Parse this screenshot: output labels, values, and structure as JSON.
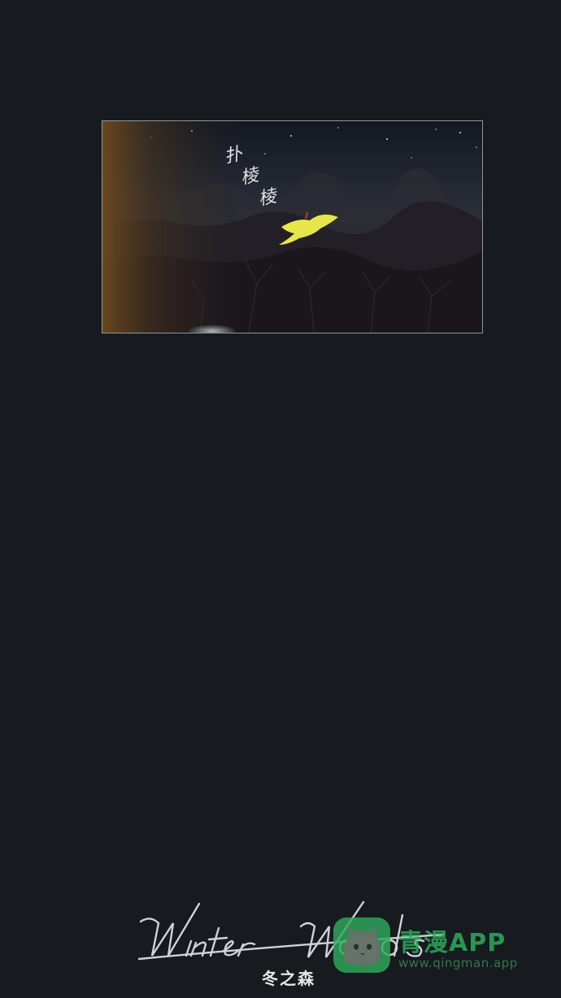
{
  "panel": {
    "sfx_chars": [
      "扑",
      "棱",
      "棱"
    ]
  },
  "title": {
    "script_text": "Winter Woods",
    "subtitle": "冬之森"
  },
  "watermark": {
    "name": "青漫APP",
    "url": "www.qingman.app"
  },
  "colors": {
    "background": "#171a1e",
    "bird": "#e6e64a",
    "watermark": "#2eaa5c"
  },
  "icons": [
    "cat-logo-icon"
  ]
}
